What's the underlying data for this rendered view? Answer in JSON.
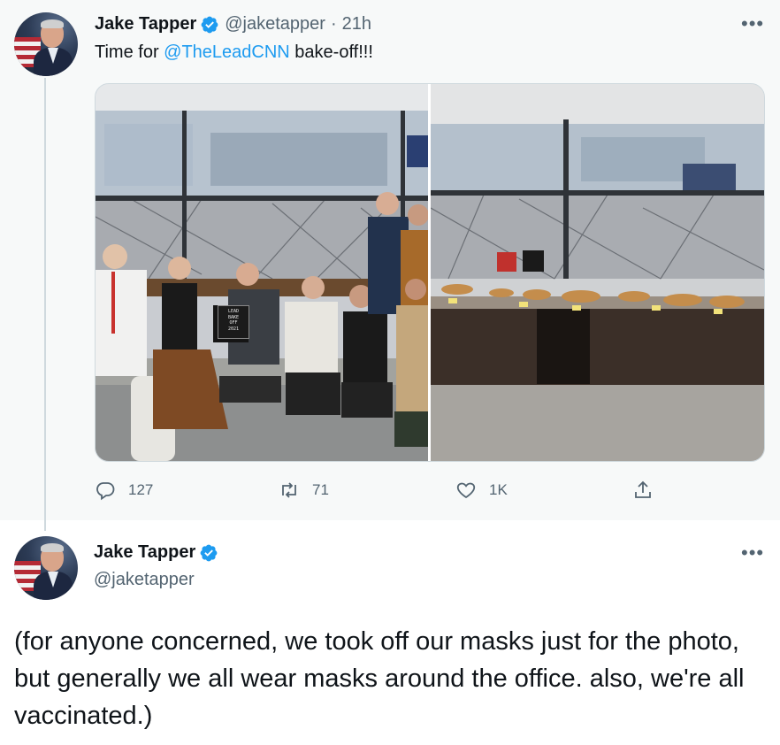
{
  "tweet1": {
    "author_name": "Jake Tapper",
    "handle": "@jaketapper",
    "separator": "·",
    "timestamp": "21h",
    "text_before": "Time for ",
    "mention": "@TheLeadCNN",
    "text_after": " bake-off!!!",
    "actions": {
      "reply_count": "127",
      "retweet_count": "71",
      "like_count": "1K"
    }
  },
  "tweet2": {
    "author_name": "Jake Tapper",
    "handle": "@jaketapper",
    "text": "(for anyone concerned, we took off our masks just for the photo, but generally we all wear masks around the office. also, we're all vaccinated.)"
  },
  "photos": {
    "sign_text": [
      "LEAD",
      "BAKE",
      "OFF",
      "2021"
    ]
  },
  "icons": {
    "verified": "verified-badge-icon",
    "more": "more-options-icon",
    "reply": "reply-icon",
    "retweet": "retweet-icon",
    "like": "heart-icon",
    "share": "share-icon"
  },
  "colors": {
    "accent": "#1d9bf0",
    "secondary_text": "#536471",
    "highlight_bg": "#f7f9f9"
  }
}
